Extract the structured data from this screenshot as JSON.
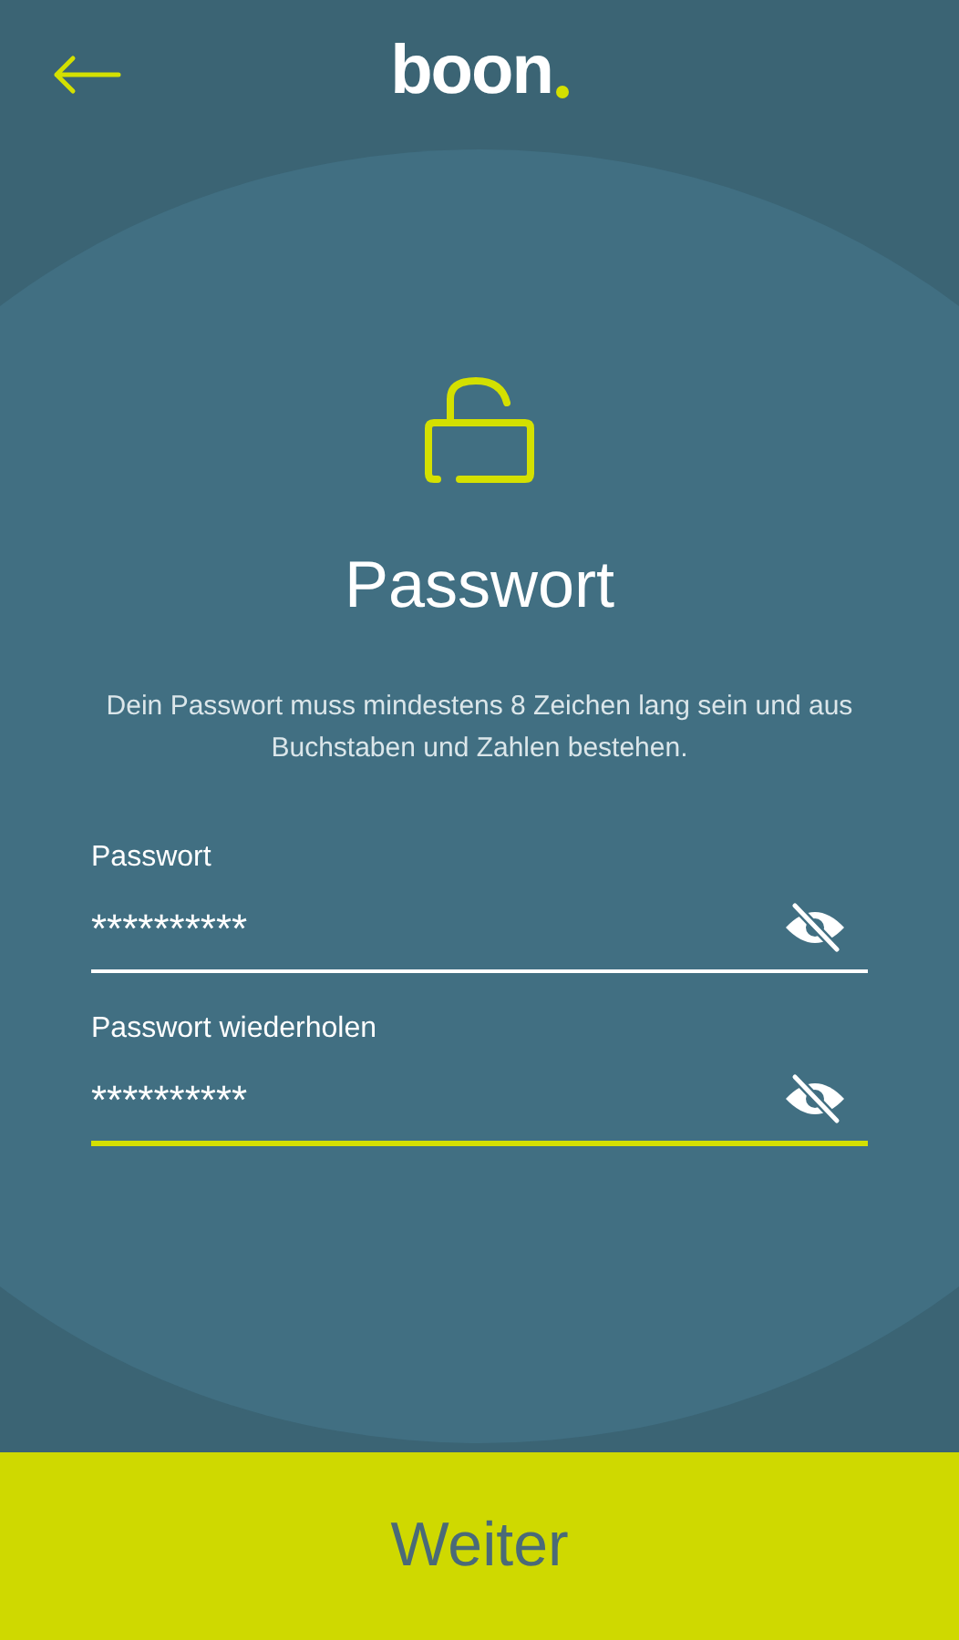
{
  "header": {
    "logo": "boon"
  },
  "title": "Passwort",
  "description": "Dein Passwort muss mindestens 8 Zeichen lang sein und aus Buchstaben und Zahlen bestehen.",
  "fields": [
    {
      "label": "Passwort",
      "value": "**********",
      "focused": false
    },
    {
      "label": "Passwort wiederholen",
      "value": "**********",
      "focused": true
    }
  ],
  "button": {
    "label": "Weiter"
  }
}
